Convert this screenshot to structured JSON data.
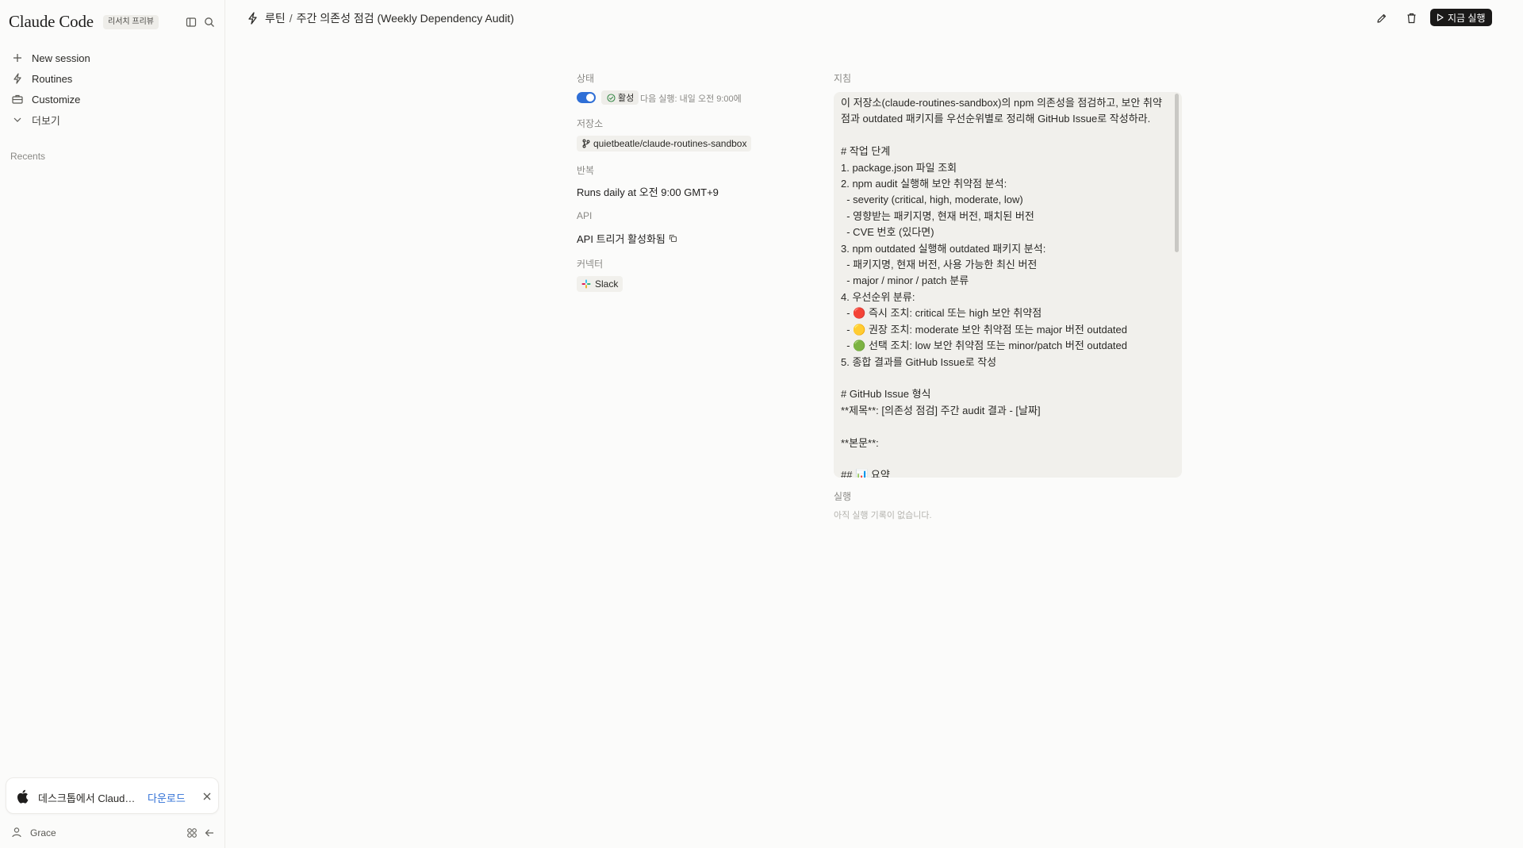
{
  "sidebar": {
    "brand": "Claude Code",
    "badge": "리서치 프리뷰",
    "nav": [
      {
        "label": "New session",
        "icon": "plus-icon"
      },
      {
        "label": "Routines",
        "icon": "bolt-icon"
      },
      {
        "label": "Customize",
        "icon": "briefcase-icon"
      },
      {
        "label": "더보기",
        "icon": "chevron-down-icon"
      }
    ],
    "recents_label": "Recents",
    "download": {
      "text": "데스크톱에서 Claude Code 사용",
      "link": "다운로드"
    },
    "user": {
      "name": "Grace"
    }
  },
  "header": {
    "section": "루틴",
    "separator": "/",
    "title": "주간 의존성 점검 (Weekly Dependency Audit)",
    "run_now": "지금 실행"
  },
  "details": {
    "status_label": "상태",
    "status_value": "활성",
    "toggle_on": true,
    "next_run": "다음 실행: 내일 오전 9:00에",
    "repo_label": "저장소",
    "repo": "quietbeatle/claude-routines-sandbox",
    "repeat_label": "반복",
    "repeat": "Runs daily at 오전 9:00 GMT+9",
    "api_label": "API",
    "api": "API 트리거 활성화됨",
    "connector_label": "커넥터",
    "connector": "Slack"
  },
  "instructions": {
    "label": "지침",
    "text": "이 저장소(claude-routines-sandbox)의 npm 의존성을 점검하고, 보안 취약\n점과 outdated 패키지를 우선순위별로 정리해 GitHub Issue로 작성하라.\n\n# 작업 단계\n1. package.json 파일 조회\n2. npm audit 실행해 보안 취약점 분석:\n  - severity (critical, high, moderate, low)\n  - 영향받는 패키지명, 현재 버전, 패치된 버전\n  - CVE 번호 (있다면)\n3. npm outdated 실행해 outdated 패키지 분석:\n  - 패키지명, 현재 버전, 사용 가능한 최신 버전\n  - major / minor / patch 분류\n4. 우선순위 분류:\n  - 🔴 즉시 조치: critical 또는 high 보안 취약점\n  - 🟡 권장 조치: moderate 보안 취약점 또는 major 버전 outdated\n  - 🟢 선택 조치: low 보안 취약점 또는 minor/patch 버전 outdated\n5. 종합 결과를 GitHub Issue로 작성\n\n# GitHub Issue 형식\n**제목**: [의존성 점검] 주간 audit 결과 - [날짜]\n\n**본문**:\n\n## 📊 요약"
  },
  "runs": {
    "label": "실행",
    "empty": "아직 실행 기록이 없습니다."
  },
  "colors": {
    "accent": "#2f6fd6",
    "run_button_bg": "#1a1918",
    "background": "#fbfbfa"
  }
}
